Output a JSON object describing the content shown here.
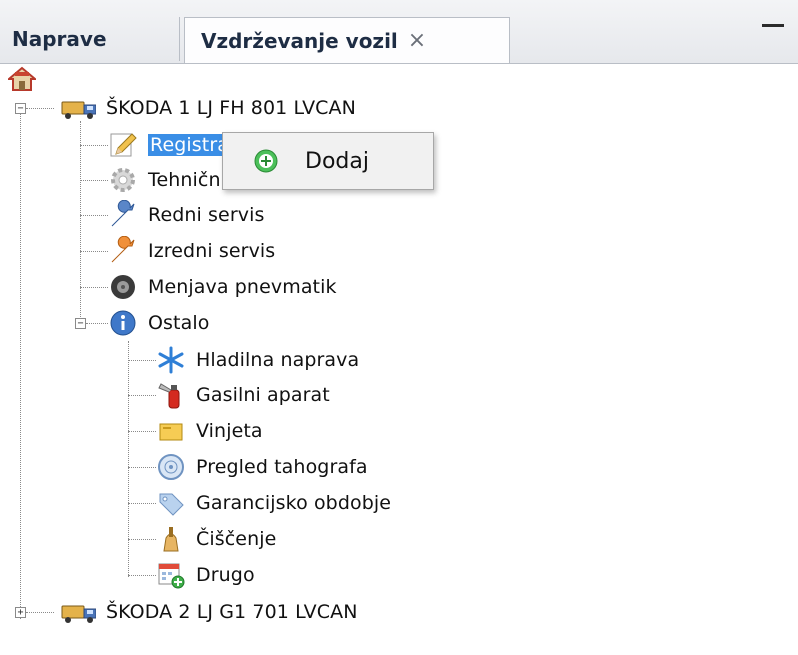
{
  "tabs": [
    {
      "label": "Naprave"
    },
    {
      "label": "Vzdrževanje vozil",
      "close": "×"
    }
  ],
  "tree": {
    "vehicle1": {
      "label": "ŠKODA 1 LJ FH 801 LVCAN",
      "children": [
        {
          "label": "Registracija",
          "icon": "pencil-icon"
        },
        {
          "label": "Tehnični pregled",
          "icon": "gear-icon"
        },
        {
          "label": "Redni servis",
          "icon": "wrench-blue-icon"
        },
        {
          "label": "Izredni servis",
          "icon": "wrench-orange-icon"
        },
        {
          "label": "Menjava pnevmatik",
          "icon": "tire-icon"
        }
      ],
      "other": {
        "label": "Ostalo",
        "children": [
          {
            "label": "Hladilna naprava",
            "icon": "snowflake-icon"
          },
          {
            "label": "Gasilni aparat",
            "icon": "fire-extinguisher-icon"
          },
          {
            "label": "Vinjeta",
            "icon": "vignette-icon"
          },
          {
            "label": "Pregled tahografa",
            "icon": "disc-icon"
          },
          {
            "label": "Garancijsko obdobje",
            "icon": "tag-icon"
          },
          {
            "label": "Čiščenje",
            "icon": "broom-icon"
          },
          {
            "label": "Drugo",
            "icon": "calendar-add-icon"
          }
        ]
      }
    },
    "vehicle2": {
      "label": "ŠKODA 2 LJ G1 701 LVCAN"
    }
  },
  "context_menu": {
    "item": "Dodaj"
  },
  "colors": {
    "selection": "#3a8ee6",
    "tab_text": "#1e2d44"
  }
}
